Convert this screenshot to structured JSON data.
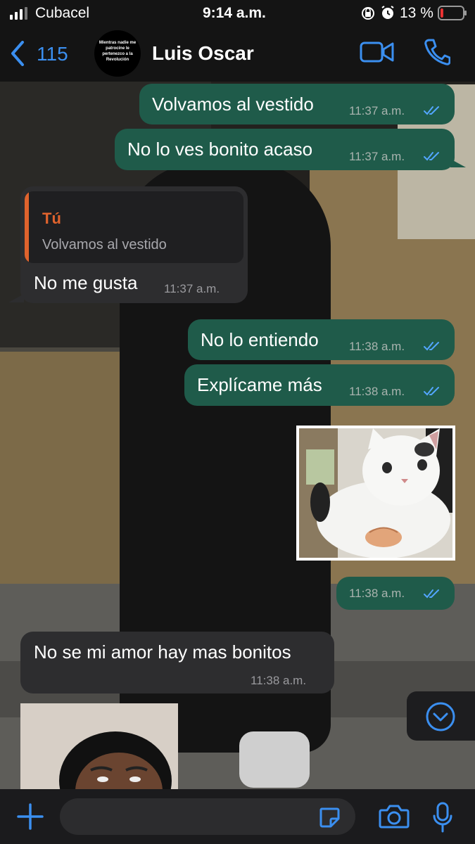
{
  "status_bar": {
    "carrier": "Cubacel",
    "time": "9:14 a.m.",
    "battery_percent": "13 %",
    "battery_level": 0.13
  },
  "header": {
    "back_count": "115",
    "contact_name": "Luis Oscar",
    "avatar_text": "Mientras nadie me patrocine le pertenezco a la Revolución"
  },
  "messages": [
    {
      "text": "Volvamos al vestido",
      "time": "11:37 a.m."
    },
    {
      "text": "No lo ves bonito acaso",
      "time": "11:37 a.m."
    },
    {
      "quote_author": "Tú",
      "quote_text": "Volvamos al vestido",
      "text": "No me gusta",
      "time": "11:37 a.m."
    },
    {
      "text": "No lo entiendo",
      "time": "11:38 a.m."
    },
    {
      "text": "Explícame más",
      "time": "11:38 a.m."
    },
    {
      "time": "11:38 a.m."
    },
    {
      "text": "No se mi amor hay mas bonitos",
      "time": "11:38 a.m."
    }
  ],
  "colors": {
    "outgoing_bubble": "#1f5b4a",
    "incoming_bubble": "#2d2d2f",
    "accent_blue": "#3b8ff0",
    "quote_accent": "#e0632d"
  }
}
